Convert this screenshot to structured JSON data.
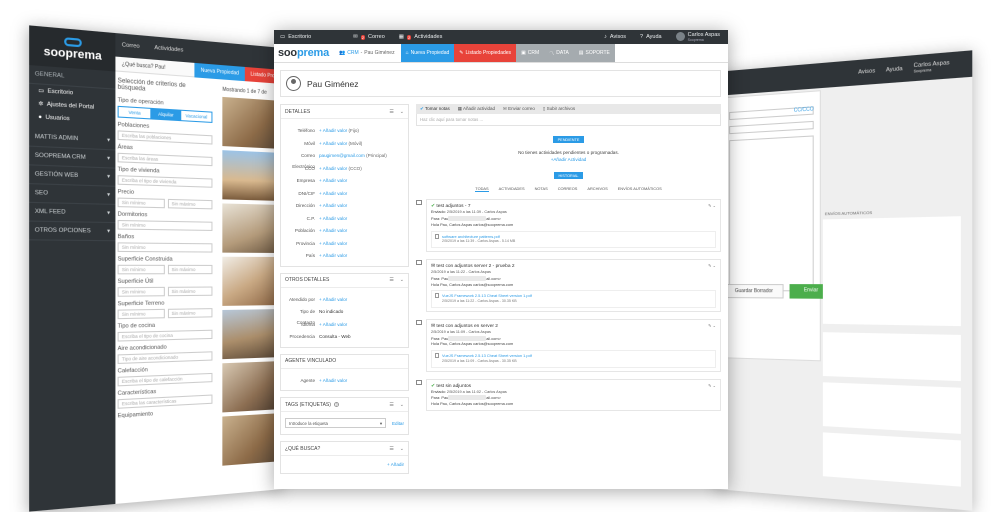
{
  "left_screen": {
    "logo_text": "sooprema",
    "top_items": [
      "Correo",
      "Actividades"
    ],
    "search_label": "¿Qué busca? Pau!",
    "tabs": [
      "Nueva Propiedad",
      "Listado Prop"
    ],
    "side_section": "GENERAL",
    "side_items": [
      "Escritorio",
      "Ajustes del Portal",
      "Usuarios"
    ],
    "side_groups": [
      "MATTIS ADMIN",
      "SOOPREMA CRM",
      "GESTIÓN WEB",
      "SEO",
      "XML FEED",
      "OTROS OPCIONES"
    ],
    "form_title": "Selección de criterios de búsqueda",
    "shown_text": "Mostrando 1 de 7 de",
    "op_label": "Tipo de operación",
    "op_options": [
      "Venta",
      "Alquilar",
      "Vacacional"
    ],
    "fields": [
      {
        "label": "Poblaciones",
        "ph": "Escriba las poblaciones"
      },
      {
        "label": "Áreas",
        "ph": "Escriba las áreas"
      },
      {
        "label": "Tipo de vivienda",
        "ph": "Escriba el tipo de vivienda"
      }
    ],
    "precio_label": "Precio",
    "min_label": "Sin mínimo",
    "max_label": "Sin máximo",
    "dormitorios_label": "Dormitorios",
    "banos_label": "Baños",
    "sup_construida": "Superficie Construida",
    "sup_util": "Superficie Útil",
    "sup_terreno": "Superficie Terreno",
    "fields2": [
      {
        "label": "Tipo de cocina",
        "ph": "Escriba el tipo de cocina"
      },
      {
        "label": "Aire acondicionado",
        "ph": "Tipo de aire acondicionado"
      },
      {
        "label": "Calefacción",
        "ph": "Escriba el tipo de calefacción"
      },
      {
        "label": "Características",
        "ph": "Escriba las características"
      },
      {
        "label": "Equipamiento",
        "ph": ""
      }
    ]
  },
  "right_screen": {
    "user_name": "Carlos Aspas",
    "user_sub": "Sooprema",
    "avisos": "Avisos",
    "ayuda": "Ayuda",
    "cc_label": "CC/CCO",
    "btn_draft": "Guardar Borrador",
    "btn_send": "Enviar",
    "auto_label": "ENVÍOS AUTOMÁTICOS"
  },
  "topbar": {
    "escritorio": "Escritorio",
    "correo": "Correo",
    "actividades": "Actividades",
    "avisos": "Avisos",
    "ayuda": "Ayuda",
    "user_name": "Carlos Aspas",
    "user_company": "Sooprema",
    "correo_badge": "2",
    "act_badge": "2"
  },
  "navbar": {
    "logo_a": "soo",
    "logo_b": "prema",
    "crumb_link": "CRM",
    "crumb_sep": "-",
    "crumb_name": "Pau Giménez",
    "btn_new": "Nueva Propiedad",
    "btn_list": "Listado Propiedades",
    "btn_crm": "CRM",
    "btn_data": "DATA",
    "btn_soporte": "SOPORTE"
  },
  "profile": {
    "name": "Pau Giménez"
  },
  "detalles": {
    "title": "DETALLES",
    "add": "+ Añadir valor",
    "rows": [
      {
        "k": "Teléfono",
        "v": "+ Añadir valor",
        "s": "(Fijo)"
      },
      {
        "k": "Móvil",
        "v": "+ Añadir valor",
        "s": "(Móvil)"
      },
      {
        "k": "Correo Electrónico",
        "v": "paugimen@gmail.com",
        "s": "(Principal)"
      },
      {
        "k": "CCO",
        "v": "+ Añadir valor",
        "s": "(CCO)"
      },
      {
        "k": "Empresa",
        "v": "+ Añadir valor",
        "s": ""
      },
      {
        "k": "DNI/CIF",
        "v": "+ Añadir valor",
        "s": ""
      },
      {
        "k": "Dirección",
        "v": "+ Añadir valor",
        "s": ""
      },
      {
        "k": "C.P.",
        "v": "+ Añadir valor",
        "s": ""
      },
      {
        "k": "Población",
        "v": "+ Añadir valor",
        "s": ""
      },
      {
        "k": "Provincia",
        "v": "+ Añadir valor",
        "s": ""
      },
      {
        "k": "País",
        "v": "+ Añadir valor",
        "s": ""
      }
    ]
  },
  "otros": {
    "title": "OTROS DETALLES",
    "rows": [
      {
        "k": "Atendido por",
        "v": "+ Añadir valor"
      },
      {
        "k": "Tipo de Contacto",
        "v": "No indicado"
      },
      {
        "k": "Idioma",
        "v": "+ Añadir valor"
      },
      {
        "k": "Procedencia",
        "v": "Consulta - Web"
      }
    ]
  },
  "agente": {
    "title": "AGENTE VINCULADO",
    "k": "Agente",
    "v": "+ Añadir valor"
  },
  "tags": {
    "title": "TAGS (ETIQUETAS)",
    "placeholder": "Introduce la etiqueta",
    "edit": "Editar"
  },
  "busca": {
    "title": "¿QUÉ BUSCA?",
    "add": "+ Añadir"
  },
  "activity": {
    "tabs": [
      "Tomar notas",
      "Añadir actividad",
      "Enviar correo",
      "Subir archivos"
    ],
    "note_ph": "Haz clic aquí para tomar notas ...",
    "pendiente": "PENDIENTE",
    "no_pending": "No tienes actividades pendientes o programadas.",
    "add_activity": "+Añadir Actividad",
    "historial": "HISTORIAL",
    "filters": [
      "TODAS",
      "ACTIVIDADES",
      "NOTAS",
      "CORREOS",
      "ARCHIVOS",
      "ENVÍOS AUTOMÁTICOS"
    ],
    "items": [
      {
        "title": "test adjuntos - 7",
        "meta": "2/5/2019 a las 11:39 - Carlos Aspas",
        "meta_prefix": "Enviado:",
        "para": "Para: Pau",
        "para_end": "ail.com>",
        "hola": "Hola Pau, Carlos Aspas carlos@sooprema.com",
        "file": "software architecture patterns.pdf",
        "fmeta": "2/5/2019 a las 11:39 - Carlos Aspas - 5.14 MB"
      },
      {
        "title": "test con adjuntos server 2 - prueba 2",
        "meta": "2/5/2019 a las 11:22 - Carlos Aspas",
        "meta_prefix": "",
        "para": "Para: Pau",
        "para_end": "ail.com>",
        "hola": "Hola Pau, Carlos Aspas carlos@sooprema.com",
        "file": "VueJS Framework 2.5.13 Cheat Sheet version 1.pdf",
        "fmeta": "2/5/2019 a las 11:22 - Carlos Aspas - 30.35 KB"
      },
      {
        "title": "test con adjuntos en server 2",
        "meta": "2/5/2019 a las 11:09 - Carlos Aspas",
        "meta_prefix": "",
        "para": "Para: Pau",
        "para_end": "ail.com>",
        "hola": "Hola Pau, Carlos Aspas carlos@sooprema.com",
        "file": "VueJS Framework 2.5.13 Cheat Sheet version 1.pdf",
        "fmeta": "2/5/2019 a las 11:09 - Carlos Aspas - 30.35 KB"
      },
      {
        "title": "test sin adjuntos",
        "meta": "2/5/2019 a las 11:02 - Carlos Aspas",
        "meta_prefix": "Enviado:",
        "para": "Para: Pau",
        "para_end": "ail.com>",
        "hola": "Hola Pau, Carlos Aspas carlos@sooprema.com",
        "file": "",
        "fmeta": ""
      }
    ]
  },
  "colors": {
    "blue": "#2b9be6",
    "red": "#e8433a",
    "dark": "#2f3438",
    "green": "#4cae4c"
  }
}
